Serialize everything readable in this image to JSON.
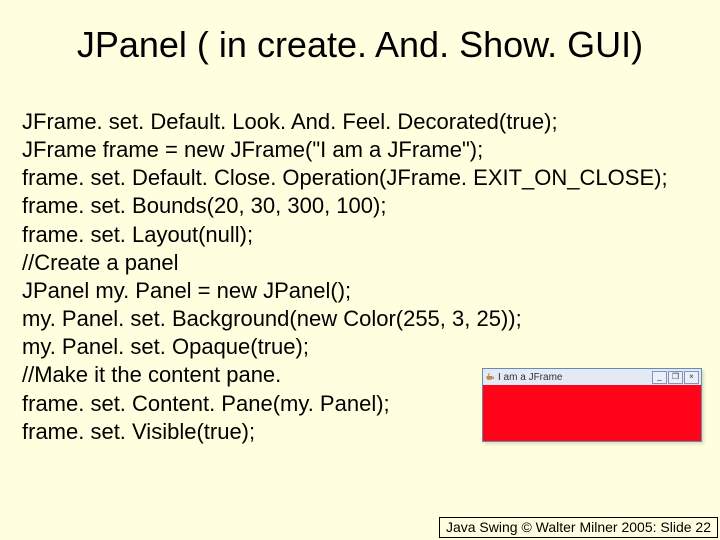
{
  "slide": {
    "title": "JPanel ( in create. And. Show. GUI)",
    "code_lines": [
      "JFrame. set. Default. Look. And. Feel. Decorated(true);",
      "JFrame frame = new JFrame(\"I am a JFrame\");",
      "frame. set. Default. Close. Operation(JFrame. EXIT_ON_CLOSE);",
      "frame. set. Bounds(20, 30, 300, 100);",
      "frame. set. Layout(null);",
      "//Create a panel",
      "JPanel my. Panel = new JPanel();",
      "my. Panel. set. Background(new Color(255, 3, 25));",
      "my. Panel. set. Opaque(true);",
      "//Make it the content pane.",
      "frame. set. Content. Pane(my. Panel);",
      "frame. set. Visible(true);"
    ],
    "mini_window": {
      "title": "I am a JFrame",
      "panel_color": "#ff0319",
      "buttons": {
        "min": "_",
        "max": "❐",
        "close": "×"
      }
    },
    "footer": "Java Swing © Walter Milner 2005: Slide 22"
  }
}
